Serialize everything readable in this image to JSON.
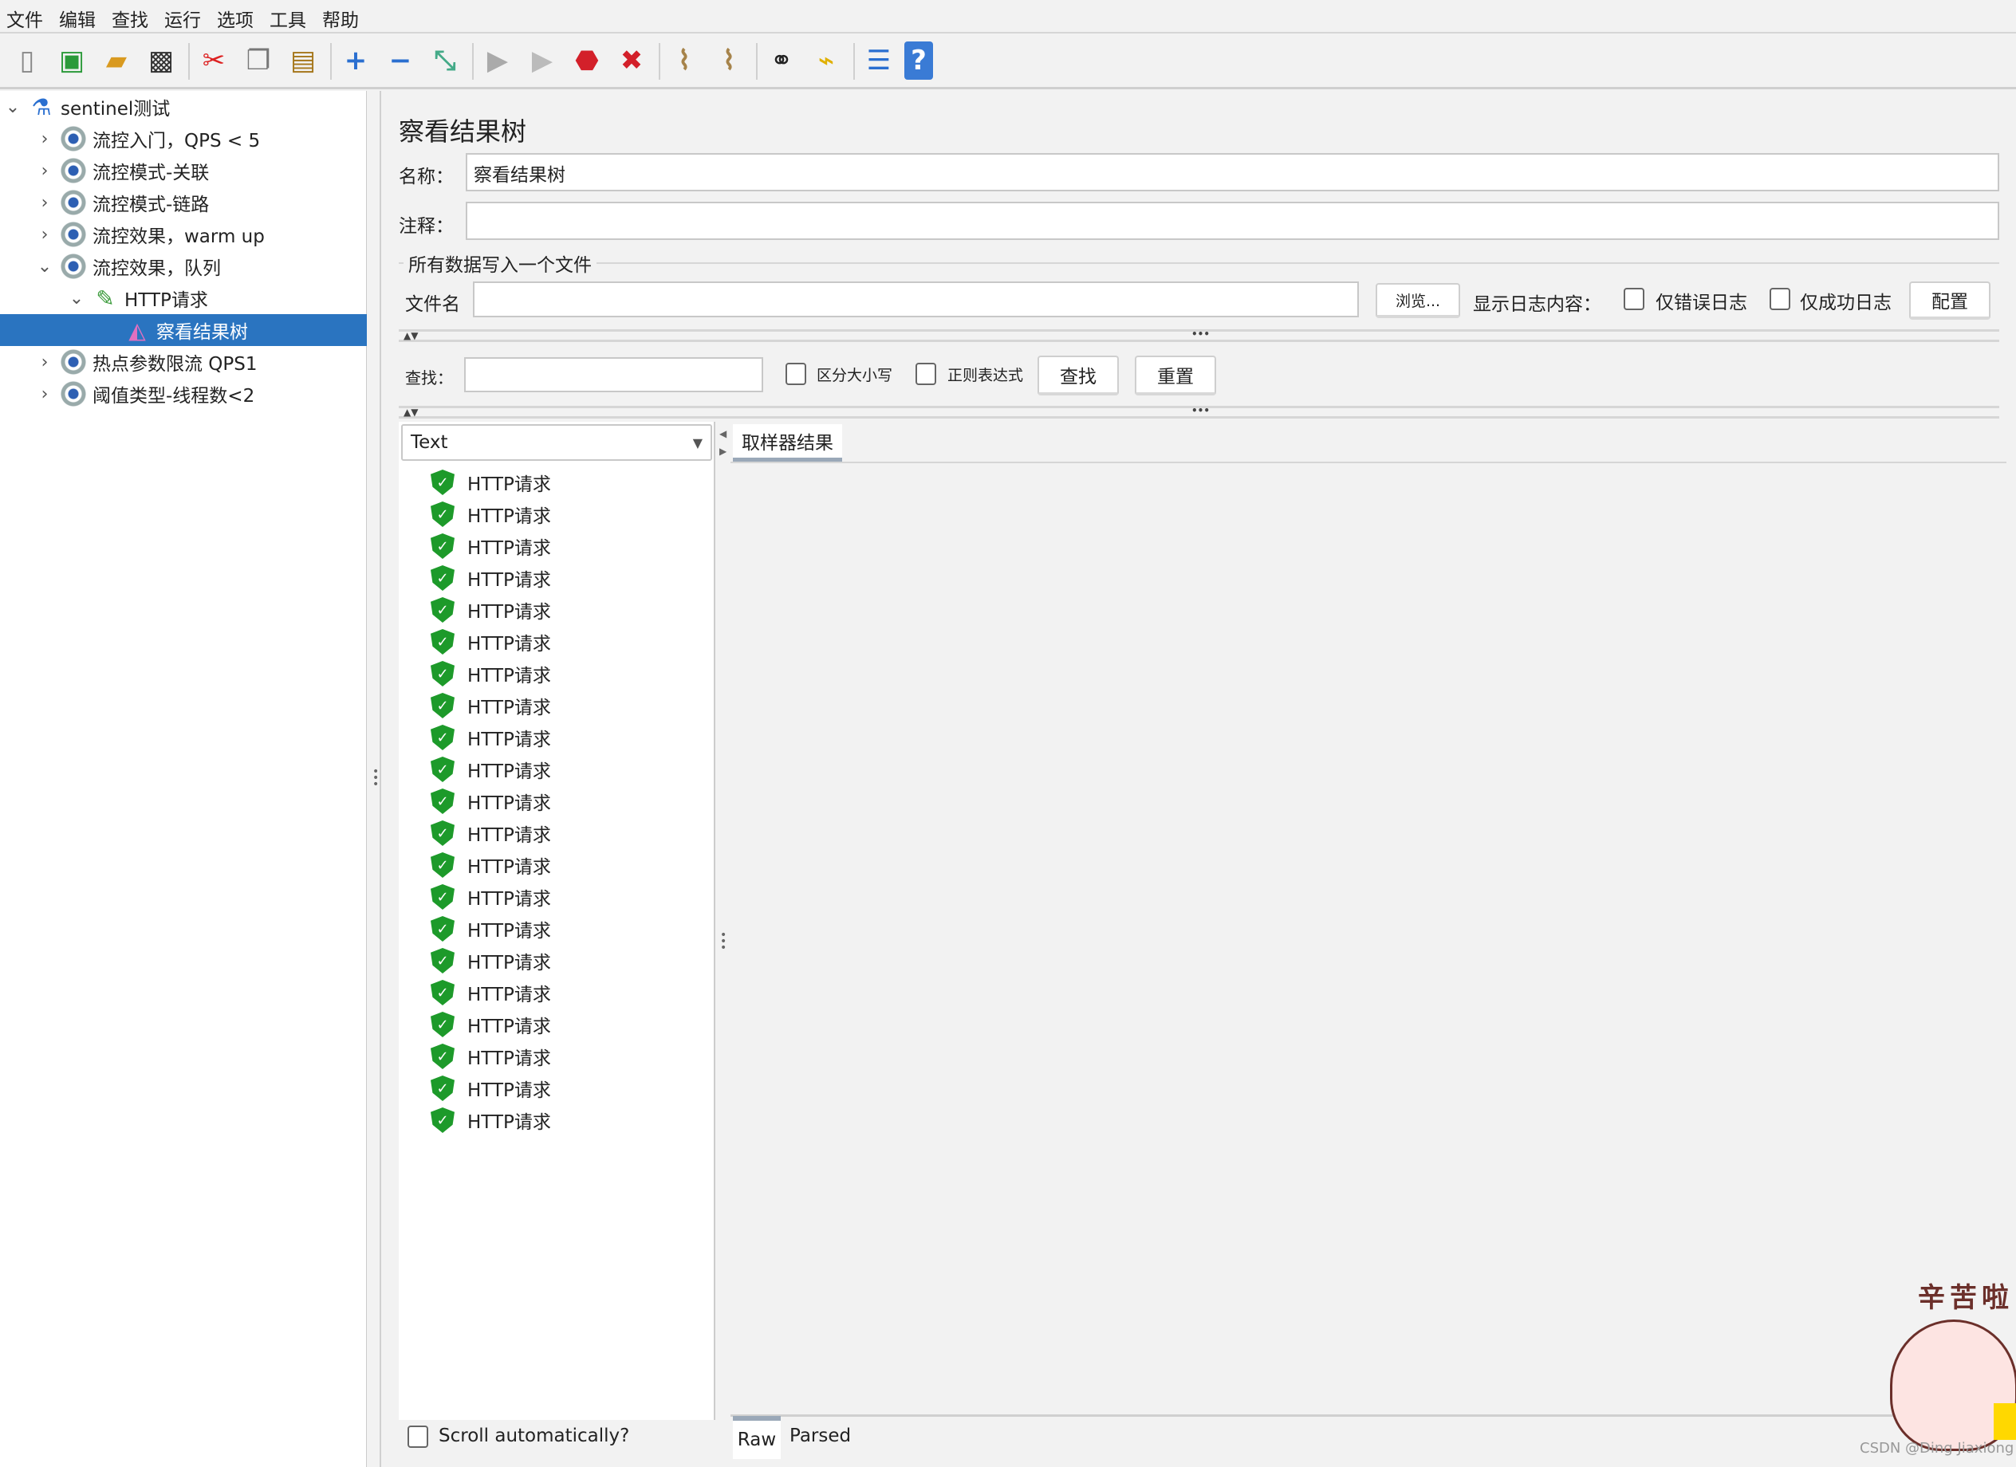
{
  "menu": [
    "文件",
    "编辑",
    "查找",
    "运行",
    "选项",
    "工具",
    "帮助"
  ],
  "toolbar": [
    {
      "icon": "new-icon",
      "glyph": "▯",
      "color": "#888"
    },
    {
      "icon": "templates-icon",
      "glyph": "▣",
      "color": "#2b9a3a"
    },
    {
      "icon": "open-icon",
      "glyph": "▰",
      "color": "#d99a20"
    },
    {
      "icon": "save-icon",
      "glyph": "▩",
      "color": "#333"
    },
    {
      "sep": true
    },
    {
      "icon": "cut-icon",
      "glyph": "✂",
      "color": "#d22"
    },
    {
      "icon": "copy-icon",
      "glyph": "❐",
      "color": "#777"
    },
    {
      "icon": "paste-icon",
      "glyph": "▤",
      "color": "#a5761a"
    },
    {
      "sep": true
    },
    {
      "icon": "expand-icon",
      "glyph": "+",
      "color": "#2a6fd0"
    },
    {
      "icon": "collapse-icon",
      "glyph": "−",
      "color": "#2a6fd0"
    },
    {
      "icon": "toggle-icon",
      "glyph": "⤡",
      "color": "#4a8"
    },
    {
      "sep": true
    },
    {
      "icon": "start-icon",
      "glyph": "▶",
      "color": "#aaa"
    },
    {
      "icon": "start-no-pause-icon",
      "glyph": "▶",
      "color": "#bbb"
    },
    {
      "icon": "stop-icon",
      "glyph": "⬣",
      "color": "#d3202a"
    },
    {
      "icon": "shutdown-icon",
      "glyph": "✖",
      "color": "#d3202a"
    },
    {
      "sep": true
    },
    {
      "icon": "clear-icon",
      "glyph": "⌇",
      "color": "#a6834a"
    },
    {
      "icon": "clear-all-icon",
      "glyph": "⌇",
      "color": "#a6834a"
    },
    {
      "sep": true
    },
    {
      "icon": "search-icon",
      "glyph": "⚭",
      "color": "#222"
    },
    {
      "icon": "reset-search-icon",
      "glyph": "⌁",
      "color": "#e0b000"
    },
    {
      "sep": true
    },
    {
      "icon": "function-helper-icon",
      "glyph": "☰",
      "color": "#2a6fd0"
    },
    {
      "icon": "help-icon",
      "glyph": "?",
      "color": "#fff",
      "bg": "#3a7bd5"
    }
  ],
  "tree": [
    {
      "label": "sentinel测试",
      "level": 0,
      "chev": "⌄",
      "icon": "flask"
    },
    {
      "label": "流控入门，QPS < 5",
      "level": 1,
      "chev": "›",
      "icon": "gear"
    },
    {
      "label": "流控模式-关联",
      "level": 1,
      "chev": "›",
      "icon": "gear"
    },
    {
      "label": "流控模式-链路",
      "level": 1,
      "chev": "›",
      "icon": "gear"
    },
    {
      "label": "流控效果，warm up",
      "level": 1,
      "chev": "›",
      "icon": "gear"
    },
    {
      "label": "流控效果，队列",
      "level": 1,
      "chev": "⌄",
      "icon": "gear"
    },
    {
      "label": "HTTP请求",
      "level": 2,
      "chev": "⌄",
      "icon": "pipette"
    },
    {
      "label": "察看结果树",
      "level": 3,
      "chev": "",
      "icon": "listener",
      "selected": true
    },
    {
      "label": "热点参数限流 QPS1",
      "level": 1,
      "chev": "›",
      "icon": "gear"
    },
    {
      "label": "阈值类型-线程数<2",
      "level": 1,
      "chev": "›",
      "icon": "gear"
    }
  ],
  "panel": {
    "title": "察看结果树",
    "name_label": "名称：",
    "name_value": "察看结果树",
    "comment_label": "注释：",
    "comment_value": "",
    "group_title": "所有数据写入一个文件",
    "filename_label": "文件名",
    "filename_value": "",
    "browse": "浏览...",
    "log_label": "显示日志内容：",
    "errors_only": "仅错误日志",
    "success_only": "仅成功日志",
    "configure": "配置",
    "search_label": "查找：",
    "search_value": "",
    "case_sensitive": "区分大小写",
    "regex": "正则表达式",
    "find": "查找",
    "reset": "重置",
    "renderer": "Text",
    "tab_sampler": "取样器结果",
    "tab_raw": "Raw",
    "tab_parsed": "Parsed",
    "scroll_auto": "Scroll automatically?"
  },
  "results": [
    "HTTP请求",
    "HTTP请求",
    "HTTP请求",
    "HTTP请求",
    "HTTP请求",
    "HTTP请求",
    "HTTP请求",
    "HTTP请求",
    "HTTP请求",
    "HTTP请求",
    "HTTP请求",
    "HTTP请求",
    "HTTP请求",
    "HTTP请求",
    "HTTP请求",
    "HTTP请求",
    "HTTP请求",
    "HTTP请求",
    "HTTP请求",
    "HTTP请求",
    "HTTP请求"
  ],
  "sticker_text": "辛苦啦",
  "watermark": "CSDN @Ding Jiaxiong"
}
